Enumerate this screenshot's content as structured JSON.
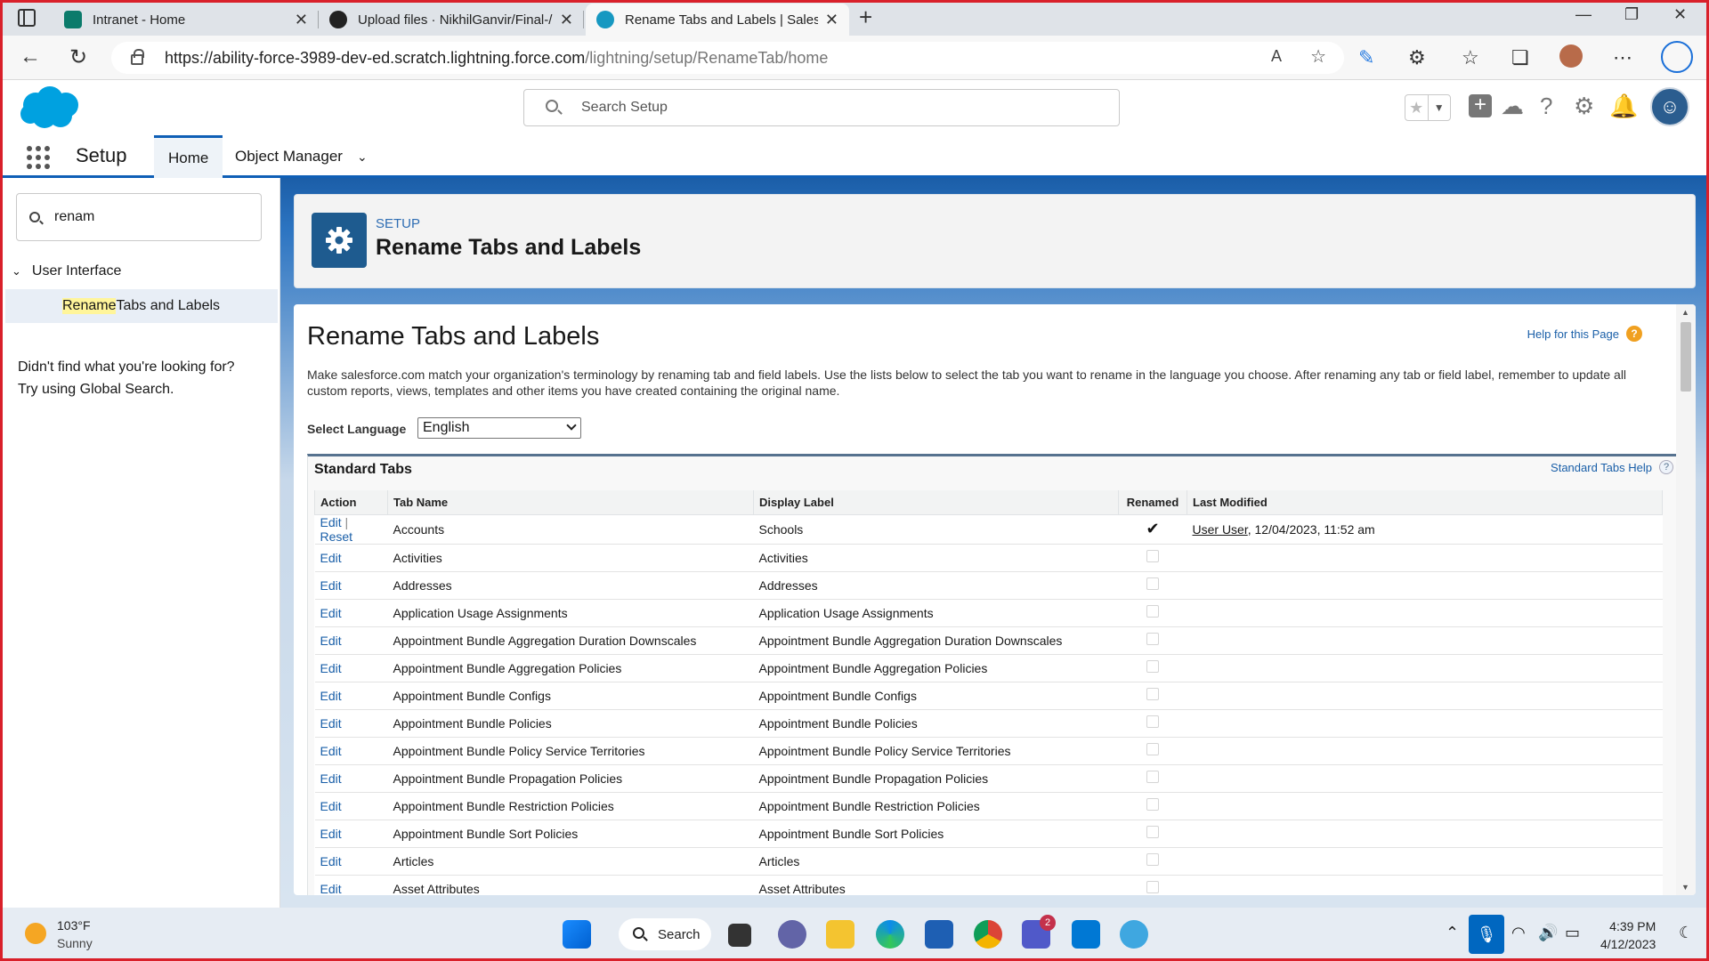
{
  "browser": {
    "tabs": [
      {
        "title": "Intranet - Home"
      },
      {
        "title": "Upload files · NikhilGanvir/Final-/"
      },
      {
        "title": "Rename Tabs and Labels | Salesfo"
      }
    ],
    "url_main": "https://ability-force-3989-dev-ed.scratch.lightning.force.com",
    "url_path": "/lightning/setup/RenameTab/home"
  },
  "header": {
    "search_placeholder": "Search Setup"
  },
  "nav": {
    "app_name": "Setup",
    "home_label": "Home",
    "object_manager_label": "Object Manager"
  },
  "sidebar": {
    "quickfind_value": "renam",
    "parent_label": "User Interface",
    "child_highlight": "Rename",
    "child_rest": " Tabs and Labels",
    "not_found_line1": "Didn't find what you're looking for?",
    "not_found_line2": "Try using Global Search."
  },
  "page_header": {
    "eyebrow": "SETUP",
    "title": "Rename Tabs and Labels"
  },
  "main": {
    "title": "Rename Tabs and Labels",
    "help_link": "Help for this Page",
    "description": "Make salesforce.com match your organization's terminology by renaming tab and field labels. Use the lists below to select the tab you want to rename in the language you choose. After renaming any tab or field label, remember to update all custom reports, views, templates and other items you have created containing the original name.",
    "language_label": "Select Language",
    "language_value": "English"
  },
  "standard_tabs": {
    "title": "Standard Tabs",
    "help": "Standard Tabs Help",
    "columns": [
      "Action",
      "Tab Name",
      "Display Label",
      "Renamed",
      "Last Modified"
    ],
    "edit_label": "Edit",
    "reset_label": "Reset",
    "rows": [
      {
        "tab": "Accounts",
        "label": "Schools",
        "renamed": true,
        "modified_by": "User User",
        "modified_at": ", 12/04/2023, 11:52 am"
      },
      {
        "tab": "Activities",
        "label": "Activities",
        "renamed": false
      },
      {
        "tab": "Addresses",
        "label": "Addresses",
        "renamed": false
      },
      {
        "tab": "Application Usage Assignments",
        "label": "Application Usage Assignments",
        "renamed": false
      },
      {
        "tab": "Appointment Bundle Aggregation Duration Downscales",
        "label": "Appointment Bundle Aggregation Duration Downscales",
        "renamed": false
      },
      {
        "tab": "Appointment Bundle Aggregation Policies",
        "label": "Appointment Bundle Aggregation Policies",
        "renamed": false
      },
      {
        "tab": "Appointment Bundle Configs",
        "label": "Appointment Bundle Configs",
        "renamed": false
      },
      {
        "tab": "Appointment Bundle Policies",
        "label": "Appointment Bundle Policies",
        "renamed": false
      },
      {
        "tab": "Appointment Bundle Policy Service Territories",
        "label": "Appointment Bundle Policy Service Territories",
        "renamed": false
      },
      {
        "tab": "Appointment Bundle Propagation Policies",
        "label": "Appointment Bundle Propagation Policies",
        "renamed": false
      },
      {
        "tab": "Appointment Bundle Restriction Policies",
        "label": "Appointment Bundle Restriction Policies",
        "renamed": false
      },
      {
        "tab": "Appointment Bundle Sort Policies",
        "label": "Appointment Bundle Sort Policies",
        "renamed": false
      },
      {
        "tab": "Articles",
        "label": "Articles",
        "renamed": false
      },
      {
        "tab": "Asset Attributes",
        "label": "Asset Attributes",
        "renamed": false
      }
    ]
  },
  "taskbar": {
    "temperature": "103°F",
    "condition": "Sunny",
    "search_label": "Search",
    "teams_badge": "2",
    "time": "4:39 PM",
    "date": "4/12/2023"
  },
  "colors": {
    "salesforce_blue": "#0f5fb6",
    "link": "#1a5fa8",
    "frame": "#d9202a"
  }
}
